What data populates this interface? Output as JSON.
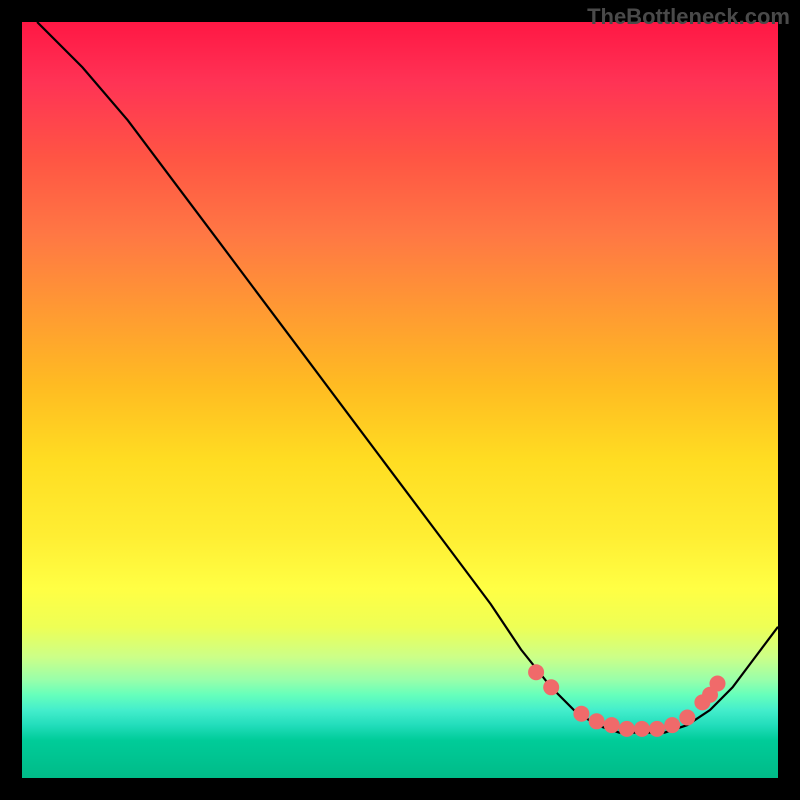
{
  "watermark": "TheBottleneck.com",
  "chart_data": {
    "type": "line",
    "title": "",
    "xlabel": "",
    "ylabel": "",
    "xlim": [
      0,
      100
    ],
    "ylim": [
      0,
      100
    ],
    "series": [
      {
        "name": "curve",
        "x": [
          2,
          8,
          14,
          20,
          26,
          32,
          38,
          44,
          50,
          56,
          62,
          66,
          70,
          73,
          76,
          79,
          82,
          85,
          88,
          91,
          94,
          97,
          100
        ],
        "y": [
          100,
          94,
          87,
          79,
          71,
          63,
          55,
          47,
          39,
          31,
          23,
          17,
          12,
          9,
          7,
          6,
          6,
          6,
          7,
          9,
          12,
          16,
          20
        ]
      }
    ],
    "markers": {
      "name": "valley-points",
      "x": [
        68,
        70,
        74,
        76,
        78,
        80,
        82,
        84,
        86,
        88,
        90,
        91,
        92
      ],
      "y": [
        14,
        12,
        8.5,
        7.5,
        7,
        6.5,
        6.5,
        6.5,
        7,
        8,
        10,
        11,
        12.5
      ],
      "color": "#f06a6a",
      "radius": 8
    }
  }
}
